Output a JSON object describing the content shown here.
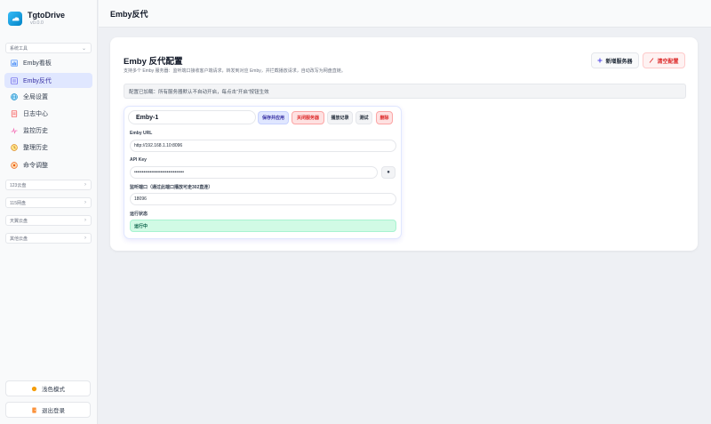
{
  "app": {
    "name": "TgtoDrive",
    "version": "v0.0.0"
  },
  "sidebar": {
    "section_system": "系统工具",
    "items": [
      {
        "label": "Emby看板",
        "icon": "bar-chart-icon"
      },
      {
        "label": "Emby反代",
        "icon": "proxy-icon"
      },
      {
        "label": "全局设置",
        "icon": "globe-icon"
      },
      {
        "label": "日志中心",
        "icon": "document-icon"
      },
      {
        "label": "监控历史",
        "icon": "pulse-icon"
      },
      {
        "label": "整理历史",
        "icon": "history-icon"
      },
      {
        "label": "命令调整",
        "icon": "command-icon"
      }
    ],
    "groups": [
      "123云盘",
      "115网盘",
      "天翼云盘",
      "其他云盘"
    ],
    "theme_button": "浅色模式",
    "logout_button": "退出登录"
  },
  "header": {
    "title": "Emby反代"
  },
  "main": {
    "title": "Emby 反代配置",
    "description": "支持多个 Emby 服务器：监听端口接收客户端请求，转发到对应 Emby，并拦截播放请求，自动改写为网盘直链。",
    "add_button": "新增服务器",
    "clear_button": "清空配置",
    "notice": "配置已加载：所有服务器默认不自动开启，每点击“开启”按钮生效"
  },
  "server": {
    "name": "Emby-1",
    "buttons": {
      "save": "保存并应用",
      "stop": "关闭服务器",
      "log": "播放记录",
      "test": "测试",
      "delete": "删除"
    },
    "url_label": "Emby URL",
    "url_value": "http://192.168.1.10:8096",
    "key_label": "API Key",
    "key_value": "••••••••••••••••••••••••••••••••",
    "port_label": "监听端口（通过此端口播放可走302直连）",
    "port_value": "18096",
    "status_label": "运行状态",
    "status_value": "运行中"
  },
  "colors": {
    "accent": "#4f46e5",
    "danger": "#dc2626",
    "success": "#065f46"
  }
}
